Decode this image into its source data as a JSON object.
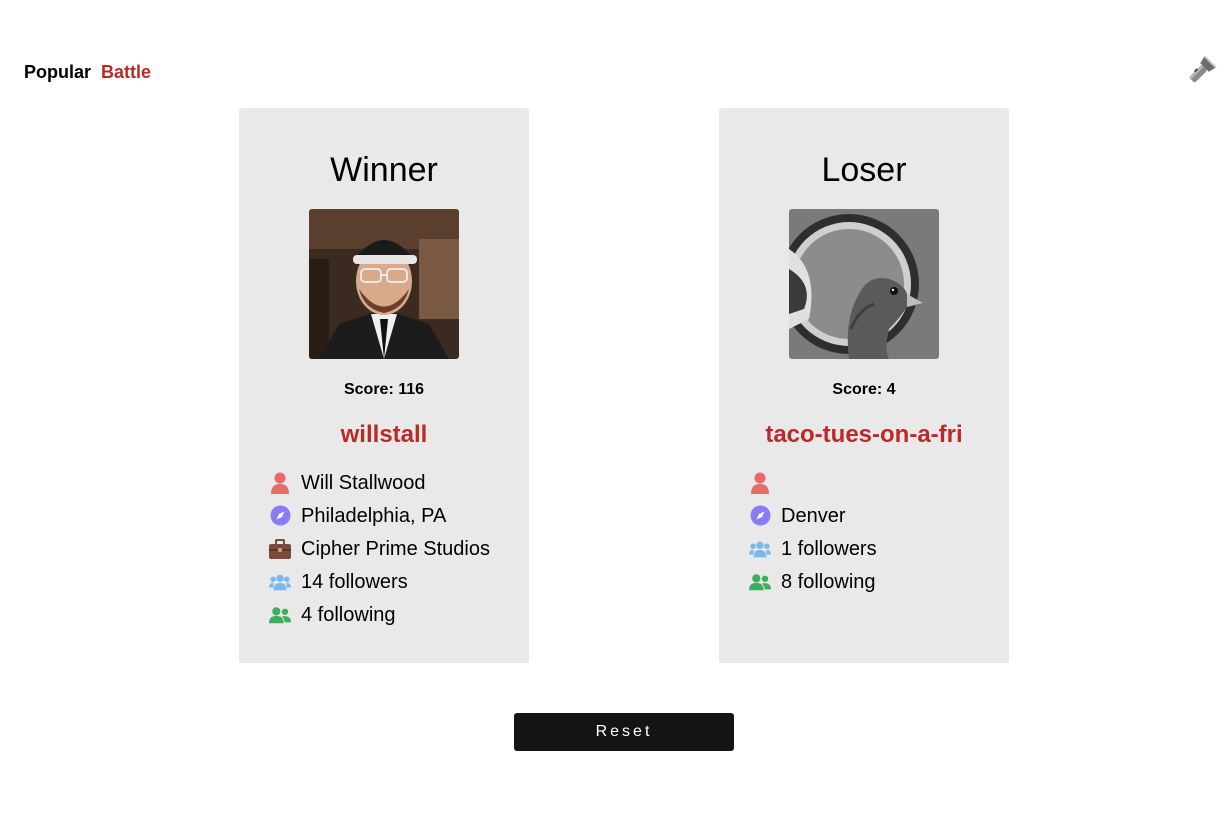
{
  "nav": {
    "popular_label": "Popular",
    "battle_label": "Battle"
  },
  "colors": {
    "accent": "#b92b27",
    "card_bg": "#e9e9e9",
    "button_bg": "#141414"
  },
  "winner": {
    "heading": "Winner",
    "score": "Score: 116",
    "username": "willstall",
    "name": "Will Stallwood",
    "location": "Philadelphia, PA",
    "company": "Cipher Prime Studios",
    "followers": "14 followers",
    "following": "4 following"
  },
  "loser": {
    "heading": "Loser",
    "score": "Score: 4",
    "username": "taco-tues-on-a-fri",
    "name": "",
    "location": "Denver",
    "followers": "1 followers",
    "following": "8 following"
  },
  "reset_label": "Reset"
}
